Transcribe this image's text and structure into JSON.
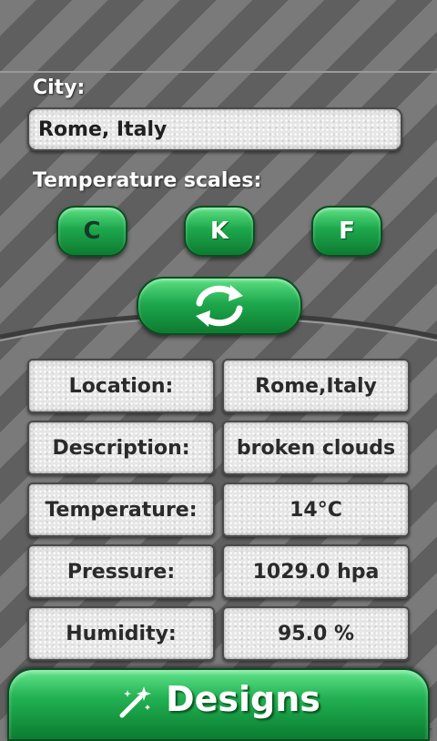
{
  "city": {
    "label": "City:",
    "value": "Rome, Italy"
  },
  "scales": {
    "label": "Temperature scales:",
    "buttons": [
      "C",
      "K",
      "F"
    ]
  },
  "refresh": {
    "icon": "refresh-arrows-icon"
  },
  "weather": [
    {
      "label": "Location:",
      "value": "Rome,Italy"
    },
    {
      "label": "Description:",
      "value": "broken clouds"
    },
    {
      "label": "Temperature:",
      "value": "14°C"
    },
    {
      "label": "Pressure:",
      "value": "1029.0 hpa"
    },
    {
      "label": "Humidity:",
      "value": "95.0 %"
    }
  ],
  "footer": {
    "designs_label": "Designs",
    "icon": "magic-wand-icon"
  },
  "colors": {
    "accent_green": "#1ea84d",
    "text_dark": "#2a2a2a"
  }
}
